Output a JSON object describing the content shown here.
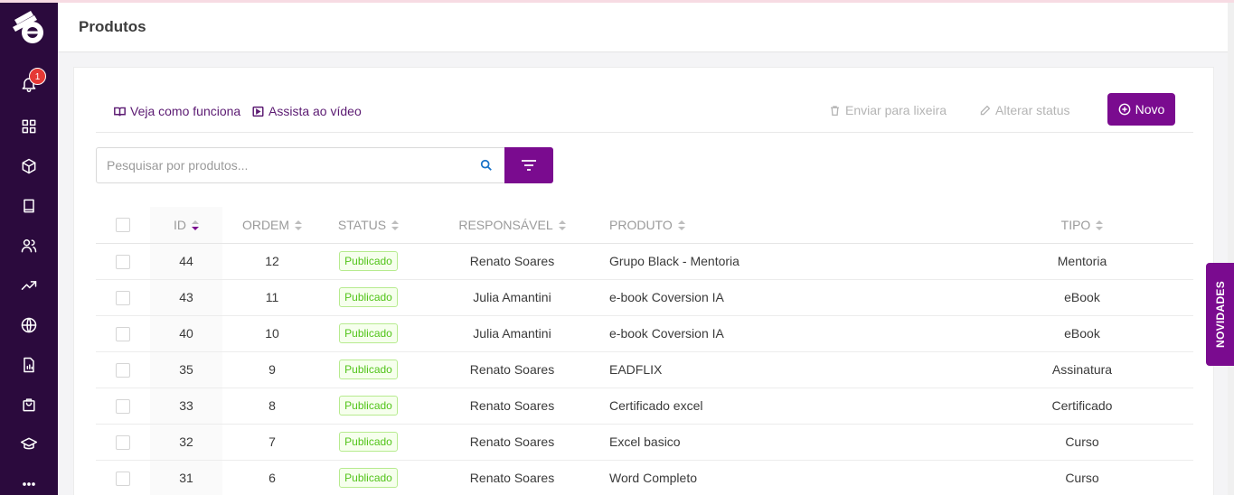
{
  "header": {
    "title": "Produtos"
  },
  "sidebar": {
    "notifications_count": "1",
    "items": [
      {
        "icon": "bell-icon"
      },
      {
        "icon": "grid-icon"
      },
      {
        "icon": "box-icon"
      },
      {
        "icon": "book-icon"
      },
      {
        "icon": "users-icon"
      },
      {
        "icon": "trending-up-icon"
      },
      {
        "icon": "globe-icon"
      },
      {
        "icon": "report-icon"
      },
      {
        "icon": "shopping-bag-icon"
      },
      {
        "icon": "graduation-cap-icon"
      },
      {
        "icon": "more-icon"
      }
    ]
  },
  "toolbar": {
    "how_it_works": "Veja como funciona",
    "watch_video": "Assista ao vídeo",
    "send_to_trash": "Enviar para lixeira",
    "change_status": "Alterar status",
    "new_button": "Novo"
  },
  "search": {
    "placeholder": "Pesquisar por produtos..."
  },
  "table": {
    "headers": {
      "id": "ID",
      "order": "ORDEM",
      "status": "STATUS",
      "responsible": "RESPONSÁVEL",
      "product": "PRODUTO",
      "type": "TIPO"
    },
    "rows": [
      {
        "id": "44",
        "order": "12",
        "status": "Publicado",
        "responsible": "Renato Soares",
        "product": "Grupo Black - Mentoria",
        "type": "Mentoria"
      },
      {
        "id": "43",
        "order": "11",
        "status": "Publicado",
        "responsible": "Julia Amantini",
        "product": "e-book Coversion IA",
        "type": "eBook"
      },
      {
        "id": "40",
        "order": "10",
        "status": "Publicado",
        "responsible": "Julia Amantini",
        "product": "e-book Coversion IA",
        "type": "eBook"
      },
      {
        "id": "35",
        "order": "9",
        "status": "Publicado",
        "responsible": "Renato Soares",
        "product": "EADFLIX",
        "type": "Assinatura"
      },
      {
        "id": "33",
        "order": "8",
        "status": "Publicado",
        "responsible": "Renato Soares",
        "product": "Certificado excel",
        "type": "Certificado"
      },
      {
        "id": "32",
        "order": "7",
        "status": "Publicado",
        "responsible": "Renato Soares",
        "product": "Excel basico",
        "type": "Curso"
      },
      {
        "id": "31",
        "order": "6",
        "status": "Publicado",
        "responsible": "Renato Soares",
        "product": "Word Completo",
        "type": "Curso"
      }
    ]
  },
  "novidades_tab": "NOVIDADES",
  "colors": {
    "primary": "#7a0b8f",
    "sidebar": "#2b0a3d",
    "status_green": "#52c41a"
  }
}
